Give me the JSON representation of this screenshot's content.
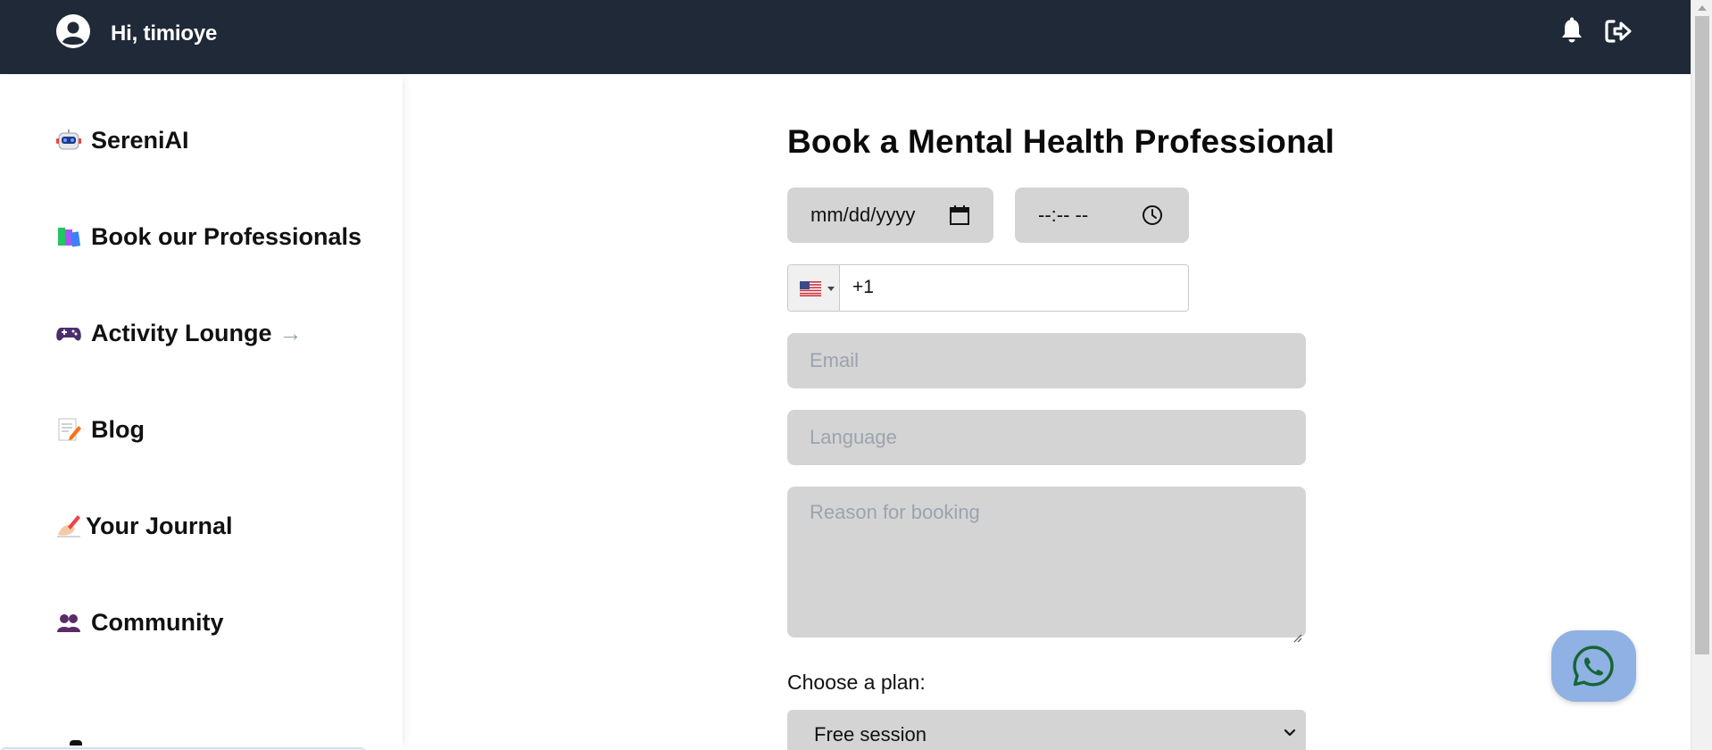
{
  "header": {
    "greeting": "Hi, timioye",
    "icons": [
      "user-circle-icon",
      "bell-icon",
      "logout-icon"
    ],
    "background_color": "#1f2937"
  },
  "sidebar": {
    "items": [
      {
        "label": "SereniAI",
        "icon": "robot-icon"
      },
      {
        "label": "Book our Professionals",
        "icon": "books-icon"
      },
      {
        "label": "Activity Lounge",
        "icon": "game-controller-icon",
        "arrow": "→"
      },
      {
        "label": "Blog",
        "icon": "memo-icon"
      },
      {
        "label": "Your Journal",
        "icon": "writing-hand-icon"
      },
      {
        "label": "Community",
        "icon": "people-icon"
      }
    ]
  },
  "form": {
    "title": "Book a Mental Health Professional",
    "date_placeholder": "mm/dd/yyyy",
    "time_placeholder": "--:-- --",
    "phone_prefix": "+1",
    "phone_country": "US",
    "email_placeholder": "Email",
    "language_placeholder": "Language",
    "reason_placeholder": "Reason for booking",
    "plan_label": "Choose a plan:",
    "plan_value": "Free session",
    "field_color": "#d4d4d4"
  },
  "floating": {
    "whatsapp_icon": "whatsapp-icon",
    "background_color": "#8fb1e3"
  }
}
